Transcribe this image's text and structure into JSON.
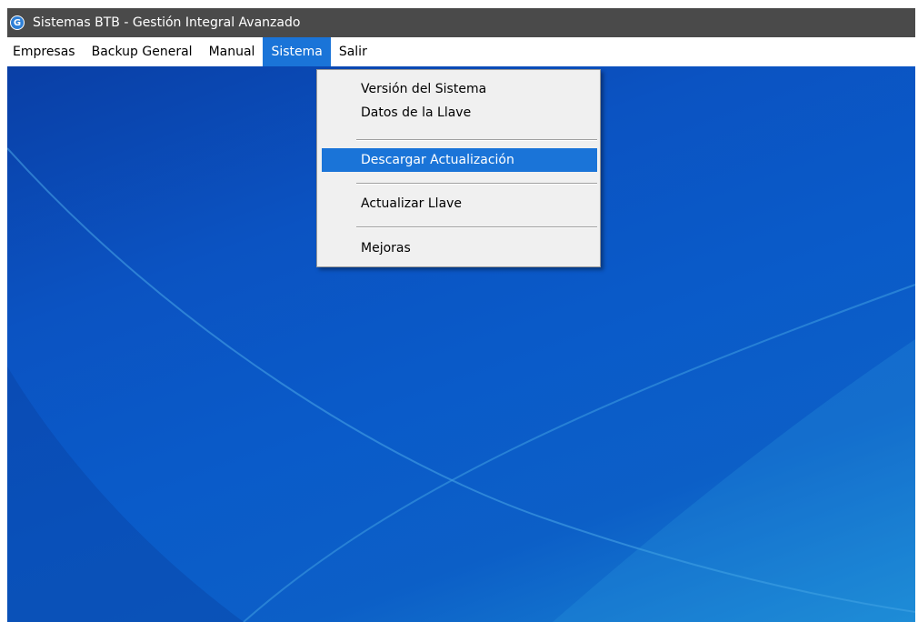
{
  "window": {
    "title": "Sistemas BTB - Gestión Integral Avanzado",
    "icon_letter": "G"
  },
  "menubar": {
    "items": [
      {
        "label": "Empresas"
      },
      {
        "label": "Backup General"
      },
      {
        "label": "Manual"
      },
      {
        "label": "Sistema",
        "active": true
      },
      {
        "label": "Salir"
      }
    ]
  },
  "dropdown": {
    "items": [
      {
        "label": "Versión del Sistema"
      },
      {
        "label": "Datos de la Llave"
      },
      {
        "label": "Descargar Actualización",
        "highlighted": true
      },
      {
        "label": "Actualizar Llave"
      },
      {
        "label": "Mejoras"
      }
    ]
  },
  "colors": {
    "titlebar": "#4a4a4a",
    "highlight": "#1a74d8",
    "desktop": "#0b53c2"
  }
}
